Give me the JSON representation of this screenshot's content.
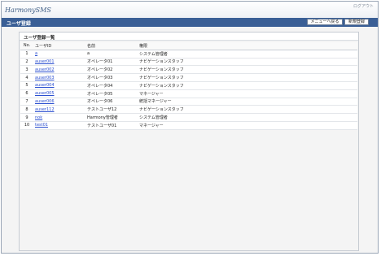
{
  "header": {
    "logo": "HarmonySMS",
    "logout": "ログアウト"
  },
  "titlebar": {
    "title": "ユーザ登録",
    "menu_button": "メニューへ戻る",
    "new_button": "新規登録"
  },
  "panel": {
    "title": "ユーザ登録一覧"
  },
  "table": {
    "columns": [
      "No.",
      "ユーザID",
      "名前",
      "権限"
    ],
    "rows": [
      {
        "no": "1",
        "id": "a",
        "name": "a",
        "role": "システム管理者"
      },
      {
        "no": "2",
        "id": "auser001",
        "name": "オペレータ01",
        "role": "ナビゲーションスタッフ"
      },
      {
        "no": "3",
        "id": "auser002",
        "name": "オペレータ02",
        "role": "ナビゲーションスタッフ"
      },
      {
        "no": "4",
        "id": "auser003",
        "name": "オペレータ03",
        "role": "ナビゲーションスタッフ"
      },
      {
        "no": "5",
        "id": "auser004",
        "name": "オペレータ04",
        "role": "ナビゲーションスタッフ"
      },
      {
        "no": "6",
        "id": "auser005",
        "name": "オペレータ05",
        "role": "マネージャー"
      },
      {
        "no": "7",
        "id": "auser006",
        "name": "オペレータ06",
        "role": "統括マネージャー"
      },
      {
        "no": "8",
        "id": "auser112",
        "name": "テストユーザ12",
        "role": "ナビゲーションスタッフ"
      },
      {
        "no": "9",
        "id": "nok",
        "name": "Harmony管理者",
        "role": "システム管理者"
      },
      {
        "no": "10",
        "id": "test01",
        "name": "テストユーザ01",
        "role": "マネージャー"
      }
    ]
  },
  "colors": {
    "titlebar": "#3a5f96",
    "link": "#2b4fd0",
    "panel_bg": "#f4f4f4"
  }
}
